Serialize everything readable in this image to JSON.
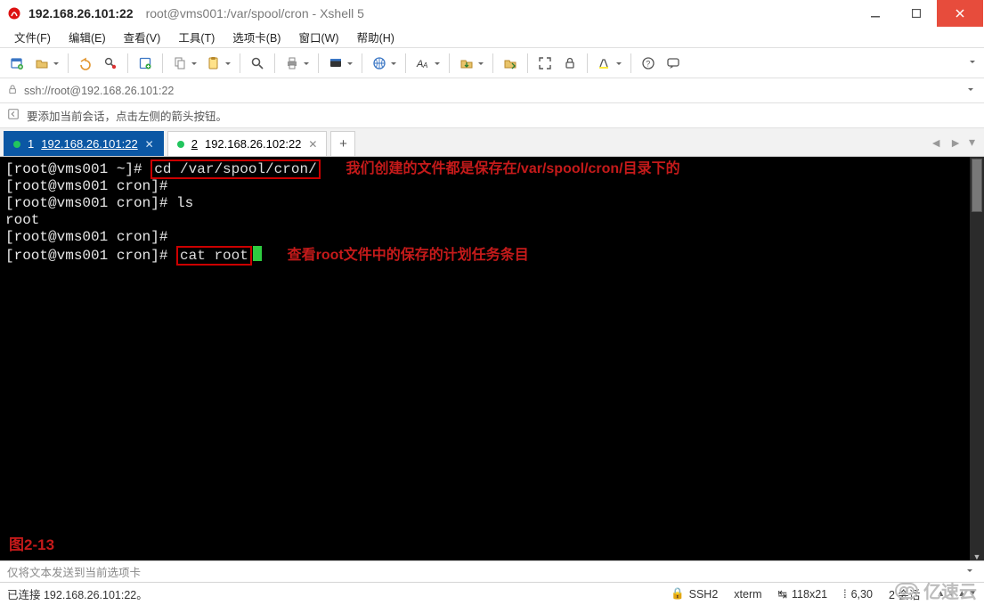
{
  "title_bar": {
    "ip": "192.168.26.101:22",
    "path": "root@vms001:/var/spool/cron - Xshell 5"
  },
  "menu": [
    "文件(F)",
    "编辑(E)",
    "查看(V)",
    "工具(T)",
    "选项卡(B)",
    "窗口(W)",
    "帮助(H)"
  ],
  "address_bar": {
    "url": "ssh://root@192.168.26.101:22"
  },
  "hint_bar": {
    "text": "要添加当前会话，点击左侧的箭头按钮。"
  },
  "tabs": {
    "items": [
      {
        "index": "1",
        "label": "192.168.26.101:22",
        "active": true
      },
      {
        "index": "2",
        "label": "192.168.26.102:22",
        "active": false
      }
    ]
  },
  "terminal": {
    "lines": {
      "p1": "[root@vms001 ~]# ",
      "cmd1": "cd /var/spool/cron/",
      "annot1": "我们创建的文件都是保存在/var/spool/cron/目录下的",
      "p2": "[root@vms001 cron]#",
      "p3": "[root@vms001 cron]# ls",
      "out3": "root",
      "p4": "[root@vms001 cron]#",
      "p5": "[root@vms001 cron]# ",
      "cmd5": "cat root",
      "annot5": "查看root文件中的保存的计划任务条目"
    },
    "figure_label": "图2-13"
  },
  "sendto": {
    "text": "仅将文本发送到当前选项卡"
  },
  "status": {
    "connected": "已连接 192.168.26.101:22。",
    "proto_icon": "🔒",
    "proto": "SSH2",
    "term": "xterm",
    "size_icon": "↹",
    "size": "118x21",
    "pos_icon": "⁞",
    "pos": "6,30",
    "sessions": "2 会话"
  },
  "watermark": {
    "text": "亿速云"
  }
}
